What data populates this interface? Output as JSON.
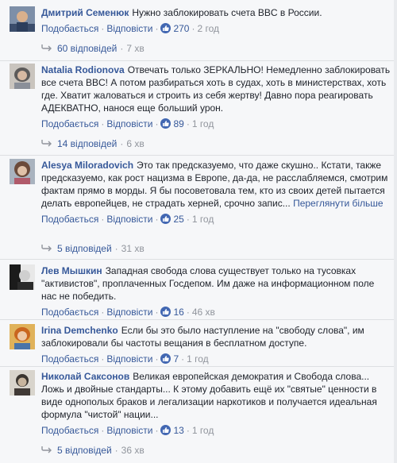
{
  "comments": [
    {
      "author": "Дмитрий Семенюк",
      "text": "Нужно заблокировать счета BBC в России.",
      "like_label": "Подобається",
      "reply_label": "Відповісти",
      "likes": "270",
      "time": "2 год",
      "replies": {
        "label": "60 відповідей",
        "time": "7 хв"
      }
    },
    {
      "author": "Natalia Rodionova",
      "text": "Отвечать только ЗЕРКАЛЬНО! Немедленно заблокировать все счета BBC! А потом разбираться хоть в судах, хоть в министерствах, хоть где. Хватит жаловаться и строить из себя жертву! Давно пора реагировать АДЕКВАТНО, нанося еще больший урон.",
      "like_label": "Подобається",
      "reply_label": "Відповісти",
      "likes": "89",
      "time": "1 год",
      "replies": {
        "label": "14 відповідей",
        "time": "6 хв"
      }
    },
    {
      "author": "Alesya Miloradovich",
      "text": "Это так предсказуемо, что даже скушно.. Кстати, также предсказуемо, как рост нацизма в Европе, да-да, не расслабляемся, смотрим фактам прямо в морды. Я бы посоветовала тем, кто из своих детей пытается делать европейцев, не страдать херней, срочно запис...",
      "more": "Переглянути більше",
      "like_label": "Подобається",
      "reply_label": "Відповісти",
      "likes": "25",
      "time": "1 год",
      "replies": {
        "label": "5 відповідей",
        "time": "31 хв"
      }
    },
    {
      "author": "Лев Мышкин",
      "text": "Западная свобода слова существует только на тусовках \"активистов\", проплаченных Госдепом. Им даже на информационном поле нас не победить.",
      "like_label": "Подобається",
      "reply_label": "Відповісти",
      "likes": "16",
      "time": "46 хв"
    },
    {
      "author": "Irina Demchenko",
      "text": "Если бы это было наступление на \"свободу слова\", им заблокировали бы частоты вещания в бесплатном доступе.",
      "like_label": "Подобається",
      "reply_label": "Відповісти",
      "likes": "7",
      "time": "1 год"
    },
    {
      "author": "Николай Саксонов",
      "text": "Великая европейская демократия и Свобода слова... Ложь и двойные стандарты... К этому добавить ещё их \"святые\" ценности в виде однополых браков и легализации наркотиков и получается идеальная формула \"чистой\" нации...",
      "like_label": "Подобається",
      "reply_label": "Відповісти",
      "likes": "13",
      "time": "1 год",
      "replies": {
        "label": "5 відповідей",
        "time": "36 хв"
      }
    }
  ],
  "colors": {
    "link": "#365899",
    "meta": "#90949c",
    "like_badge": "#4267b2",
    "text": "#1d2129"
  }
}
